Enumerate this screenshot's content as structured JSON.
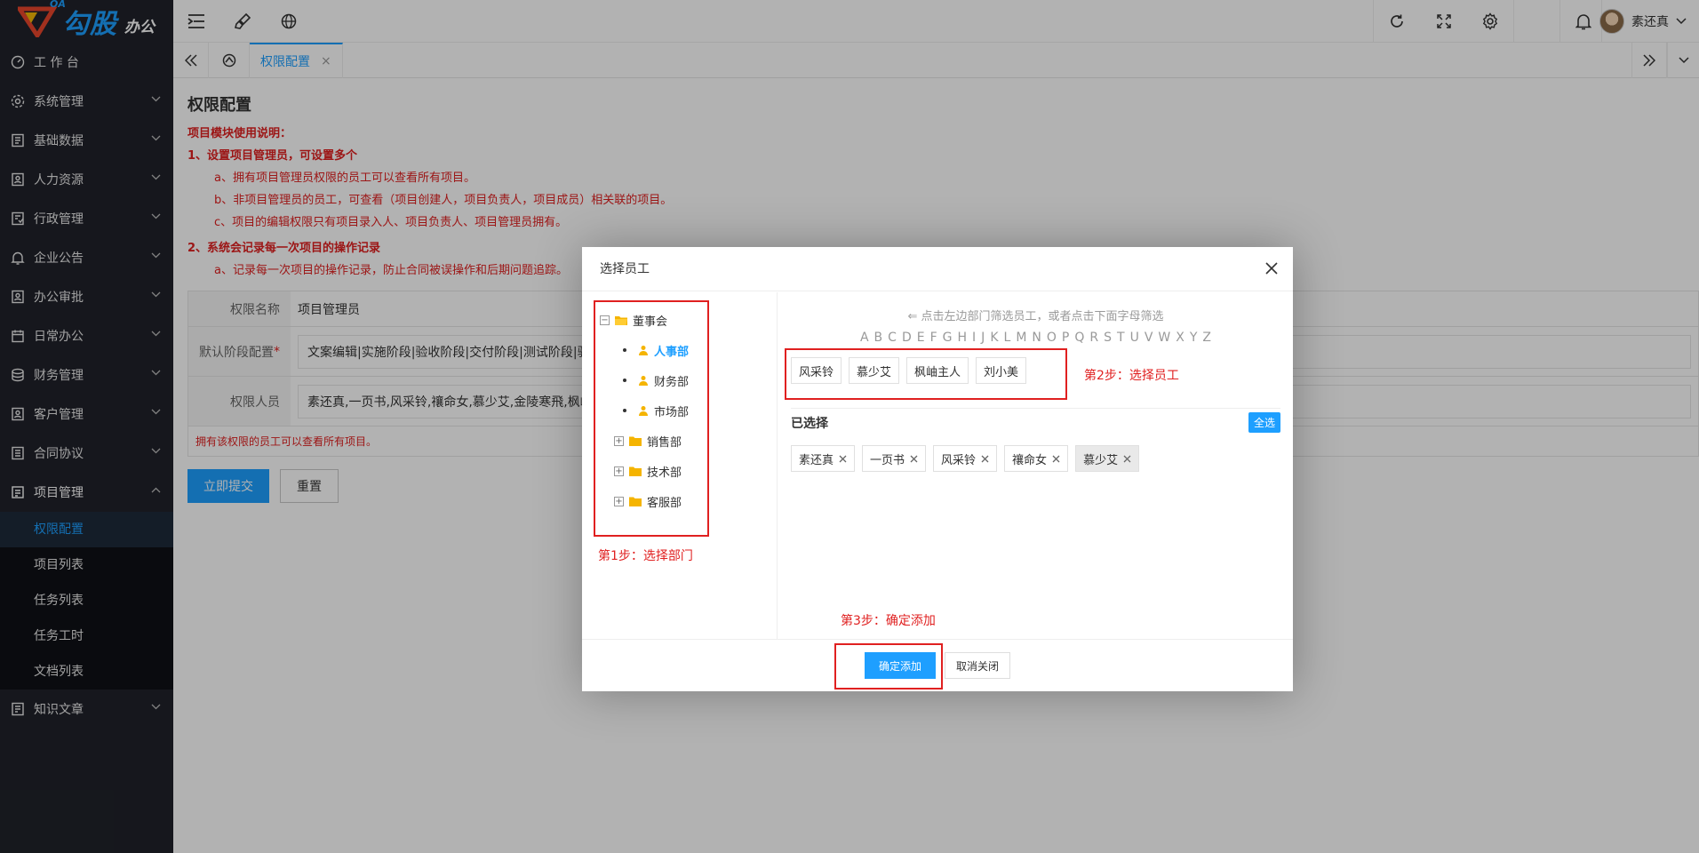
{
  "brand": {
    "oa": "OA",
    "name": "勾股",
    "sub": "办公"
  },
  "sidebar": {
    "items": [
      {
        "label": "工 作 台",
        "icon": "dashboard-icon"
      },
      {
        "label": "系统管理",
        "icon": "settings-icon"
      },
      {
        "label": "基础数据",
        "icon": "database-icon"
      },
      {
        "label": "人力资源",
        "icon": "user-card-icon"
      },
      {
        "label": "行政管理",
        "icon": "admin-icon"
      },
      {
        "label": "企业公告",
        "icon": "bell-icon"
      },
      {
        "label": "办公审批",
        "icon": "approval-icon"
      },
      {
        "label": "日常办公",
        "icon": "calendar-icon"
      },
      {
        "label": "财务管理",
        "icon": "finance-icon"
      },
      {
        "label": "客户管理",
        "icon": "customer-icon"
      },
      {
        "label": "合同协议",
        "icon": "contract-icon"
      },
      {
        "label": "项目管理",
        "icon": "project-icon"
      },
      {
        "label": "知识文章",
        "icon": "article-icon"
      }
    ],
    "project_sub": [
      "权限配置",
      "项目列表",
      "任务列表",
      "任务工时",
      "文档列表"
    ]
  },
  "header": {
    "user_name": "素还真"
  },
  "tabs": {
    "active_label": "权限配置",
    "close": "×"
  },
  "page": {
    "title": "权限配置",
    "notice": {
      "heading": "项目模块使用说明：",
      "l1": "1、设置项目管理员，可设置多个",
      "l1a": "a、拥有项目管理员权限的员工可以查看所有项目。",
      "l1b": "b、非项目管理员的员工，可查看（项目创建人，项目负责人，项目成员）相关联的项目。",
      "l1c": "c、项目的编辑权限只有项目录入人、项目负责人、项目管理员拥有。",
      "l2": "2、系统会记录每一次项目的操作记录",
      "l2a": "a、记录每一次项目的操作记录，防止合同被误操作和后期问题追踪。"
    },
    "form": {
      "name_label": "权限名称",
      "name_value": "项目管理员",
      "stage_label": "默认阶段配置",
      "stage_value": "文案编辑|实施阶段|验收阶段|交付阶段|测试阶段|验",
      "people_label": "权限人员",
      "people_value": "素还真,一页书,风采铃,禳命女,慕少艾,金陵寒飛,枫岫",
      "note": "拥有该权限的员工可以查看所有项目。",
      "submit": "立即提交",
      "reset": "重置"
    }
  },
  "modal": {
    "title": "选择员工",
    "tree": {
      "root": "董事会",
      "children": [
        {
          "label": "人事部",
          "type": "leaf"
        },
        {
          "label": "财务部",
          "type": "leaf"
        },
        {
          "label": "市场部",
          "type": "leaf"
        },
        {
          "label": "销售部",
          "type": "folder"
        },
        {
          "label": "技术部",
          "type": "folder"
        },
        {
          "label": "客服部",
          "type": "folder"
        }
      ]
    },
    "hint": "⇐ 点击左边部门筛选员工，或者点击下面字母筛选",
    "letters": [
      "A",
      "B",
      "C",
      "D",
      "E",
      "F",
      "G",
      "H",
      "I",
      "J",
      "K",
      "L",
      "M",
      "N",
      "O",
      "P",
      "Q",
      "R",
      "S",
      "T",
      "U",
      "V",
      "W",
      "X",
      "Y",
      "Z"
    ],
    "employees": [
      "风采铃",
      "慕少艾",
      "枫岫主人",
      "刘小美"
    ],
    "selected_label": "已选择",
    "select_all": "全选",
    "selected": [
      "素还真",
      "一页书",
      "风采铃",
      "禳命女",
      "慕少艾"
    ],
    "confirm": "确定添加",
    "cancel": "取消关闭",
    "step1": "第1步：选择部门",
    "step2": "第2步：选择员工",
    "step3": "第3步：确定添加"
  },
  "colors": {
    "accent": "#1e9fff",
    "sidebar": "#20222a",
    "annotation": "#e02020"
  }
}
